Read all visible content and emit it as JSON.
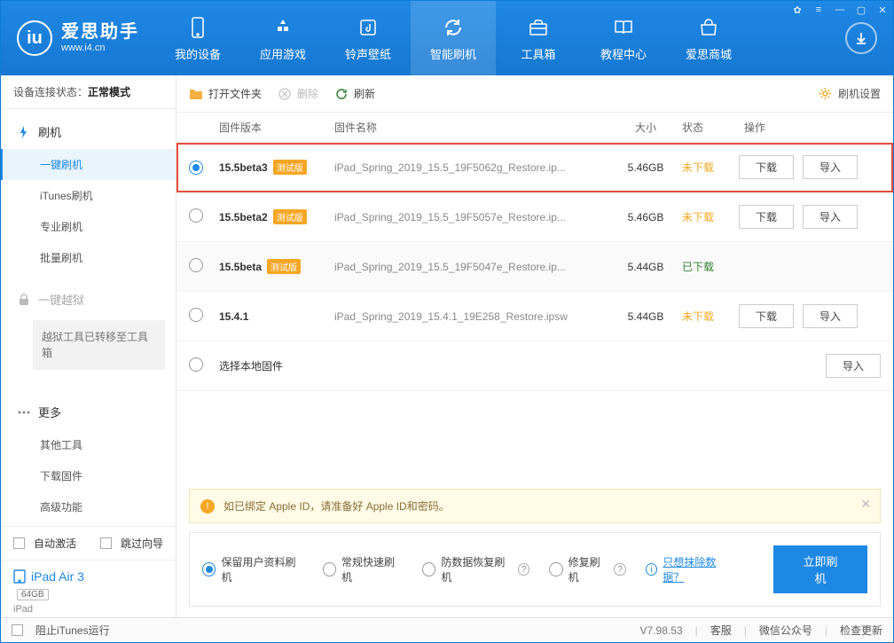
{
  "logo": {
    "title": "爱思助手",
    "subtitle": "www.i4.cn"
  },
  "nav": {
    "items": [
      {
        "label": "我的设备"
      },
      {
        "label": "应用游戏"
      },
      {
        "label": "铃声壁纸"
      },
      {
        "label": "智能刷机"
      },
      {
        "label": "工具箱"
      },
      {
        "label": "教程中心"
      },
      {
        "label": "爱思商城"
      }
    ],
    "active_index": 3
  },
  "device_status_label": "设备连接状态：",
  "device_status_value": "正常模式",
  "sidebar": {
    "flash_head": "刷机",
    "items_flash": [
      {
        "label": "一键刷机"
      },
      {
        "label": "iTunes刷机"
      },
      {
        "label": "专业刷机"
      },
      {
        "label": "批量刷机"
      }
    ],
    "active_flash_index": 0,
    "jailbreak_head": "一键越狱",
    "jailbreak_note": "越狱工具已转移至工具箱",
    "more_head": "更多",
    "items_more": [
      {
        "label": "其他工具"
      },
      {
        "label": "下载固件"
      },
      {
        "label": "高级功能"
      }
    ]
  },
  "side_foot": {
    "auto_activate": "自动激活",
    "skip_guide": "跳过向导",
    "device_name": "iPad Air 3",
    "device_capacity": "64GB",
    "device_type": "iPad"
  },
  "toolbar": {
    "open_folder": "打开文件夹",
    "delete": "删除",
    "refresh": "刷新",
    "settings": "刷机设置"
  },
  "columns": {
    "version": "固件版本",
    "name": "固件名称",
    "size": "大小",
    "status": "状态",
    "action": "操作"
  },
  "rows": [
    {
      "selected": true,
      "version": "15.5beta3",
      "beta": "测试版",
      "name": "iPad_Spring_2019_15.5_19F5062g_Restore.ip...",
      "size": "5.46GB",
      "status": "未下载",
      "status_kind": "nd",
      "highlight": true,
      "show_download": true
    },
    {
      "selected": false,
      "version": "15.5beta2",
      "beta": "测试版",
      "name": "iPad_Spring_2019_15.5_19F5057e_Restore.ip...",
      "size": "5.46GB",
      "status": "未下载",
      "status_kind": "nd",
      "show_download": true
    },
    {
      "selected": false,
      "version": "15.5beta",
      "beta": "测试版",
      "name": "iPad_Spring_2019_15.5_19F5047e_Restore.ip...",
      "size": "5.44GB",
      "status": "已下载",
      "status_kind": "dl",
      "alt": true,
      "show_download": false
    },
    {
      "selected": false,
      "version": "15.4.1",
      "beta": "",
      "name": "iPad_Spring_2019_15.4.1_19E258_Restore.ipsw",
      "size": "5.44GB",
      "status": "未下载",
      "status_kind": "nd",
      "show_download": true
    },
    {
      "selected": false,
      "version": "",
      "beta": "",
      "name_is_label": true,
      "name": "选择本地固件",
      "size": "",
      "status": "",
      "show_download": false,
      "only_import": true
    }
  ],
  "row_buttons": {
    "download": "下载",
    "import": "导入"
  },
  "warning": "如已绑定 Apple ID，请准备好 Apple ID和密码。",
  "options": {
    "keep_user": "保留用户资料刷机",
    "normal_fast": "常规快速刷机",
    "anti_loss": "防数据恢复刷机",
    "repair": "修复刷机",
    "erase_link": "只想抹除数据？",
    "selected_index": 0,
    "primary": "立即刷机"
  },
  "statusbar": {
    "block_itunes": "阻止iTunes运行",
    "version": "V7.98.53",
    "support": "客服",
    "wechat": "微信公众号",
    "check_update": "检查更新"
  }
}
